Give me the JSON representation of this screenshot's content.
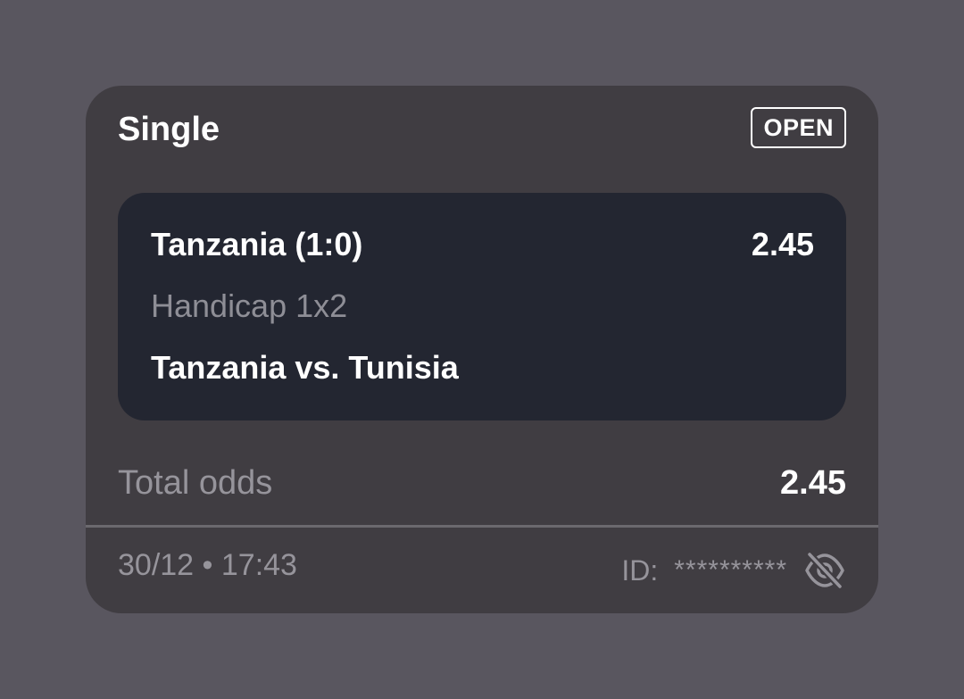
{
  "bet": {
    "type": "Single",
    "status": "OPEN",
    "selection": {
      "name": "Tanzania (1:0)",
      "odds": "2.45",
      "market": "Handicap 1x2",
      "match": "Tanzania vs. Tunisia"
    },
    "total_odds_label": "Total odds",
    "total_odds_value": "2.45",
    "timestamp": "30/12 • 17:43",
    "id_label": "ID:",
    "id_value": "**********",
    "id_visibility_icon": "eye-off-icon"
  },
  "colors": {
    "background": "#59565f",
    "card": "#403d42",
    "selection_card": "#232631",
    "text_primary": "#ffffff",
    "text_secondary": "#96949b"
  }
}
